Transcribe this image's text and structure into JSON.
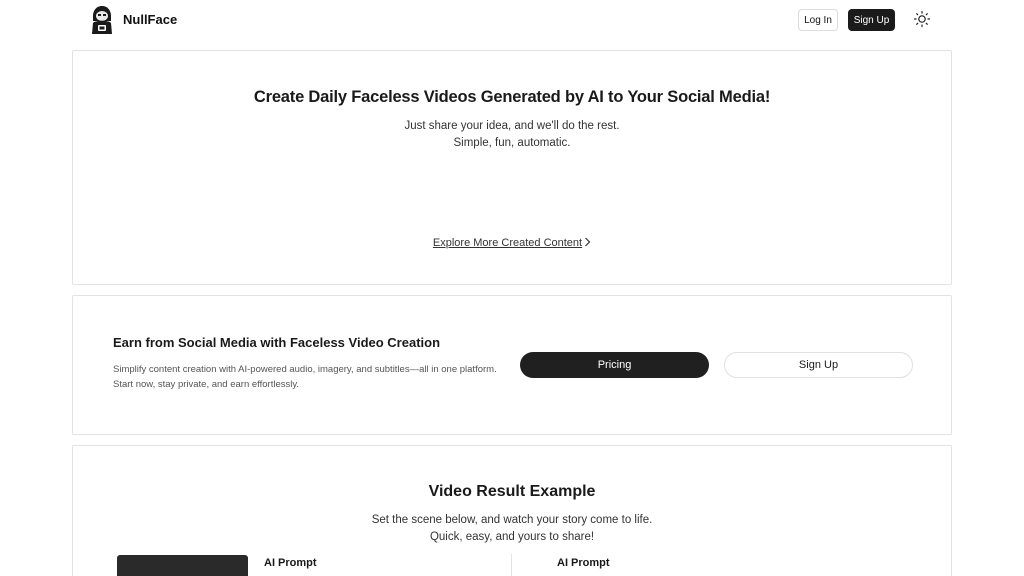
{
  "header": {
    "brand": "NullFace",
    "login_label": "Log In",
    "signup_label": "Sign Up"
  },
  "hero": {
    "title": "Create Daily Faceless Videos Generated by AI to Your Social Media!",
    "subtitle_line1": "Just share your idea, and we'll do the rest.",
    "subtitle_line2": "Simple, fun, automatic.",
    "explore_link": "Explore More Created Content"
  },
  "earn": {
    "title": "Earn from Social Media with Faceless Video Creation",
    "description": "Simplify content creation with AI-powered audio, imagery, and subtitles—all in one platform. Start now, stay private, and earn effortlessly.",
    "pricing_label": "Pricing",
    "signup_label": "Sign Up"
  },
  "example": {
    "title": "Video Result Example",
    "subtitle_line1": "Set the scene below, and watch your story come to life.",
    "subtitle_line2": "Quick, easy, and yours to share!",
    "prompt_label_1": "AI Prompt",
    "prompt_label_2": "AI Prompt"
  },
  "colors": {
    "primary_button": "#1b1b1b",
    "border": "#e3e3e3"
  },
  "icons": {
    "logo": "hooded-figure-logo",
    "theme": "sun-icon",
    "link_arrow": "chevron-right-icon"
  }
}
